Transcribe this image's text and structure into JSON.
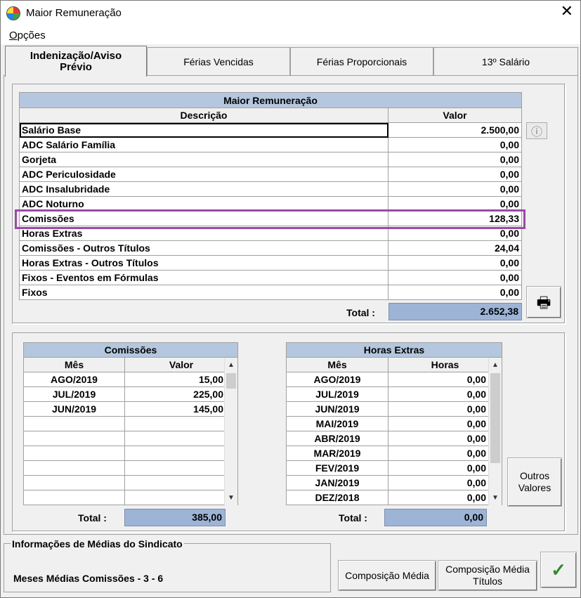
{
  "window": {
    "title": "Maior Remuneração",
    "close_glyph": "✕"
  },
  "menu": {
    "opcoes_first": "O",
    "opcoes_rest": "pções"
  },
  "tabs": [
    {
      "label": "Indenização/Aviso Prévio"
    },
    {
      "label": "Férias Vencidas"
    },
    {
      "label": "Férias Proporcionais"
    },
    {
      "label": "13º Salário"
    }
  ],
  "main_table": {
    "title": "Maior Remuneração",
    "col_desc": "Descrição",
    "col_valor": "Valor",
    "rows": [
      {
        "desc": "Salário Base",
        "valor": "2.500,00"
      },
      {
        "desc": "ADC Salário Família",
        "valor": "0,00"
      },
      {
        "desc": "Gorjeta",
        "valor": "0,00"
      },
      {
        "desc": "ADC Periculosidade",
        "valor": "0,00"
      },
      {
        "desc": "ADC Insalubridade",
        "valor": "0,00"
      },
      {
        "desc": "ADC Noturno",
        "valor": "0,00"
      },
      {
        "desc": "Comissões",
        "valor": "128,33"
      },
      {
        "desc": "Horas Extras",
        "valor": "0,00"
      },
      {
        "desc": "Comissões - Outros Títulos",
        "valor": "24,04"
      },
      {
        "desc": "Horas Extras - Outros Títulos",
        "valor": "0,00"
      },
      {
        "desc": "Fixos - Eventos em Fórmulas",
        "valor": "0,00"
      },
      {
        "desc": "Fixos",
        "valor": "0,00"
      }
    ],
    "total_label": "Total :",
    "total_value": "2.652,38"
  },
  "comissoes": {
    "title": "Comissões",
    "col_mes": "Mês",
    "col_valor": "Valor",
    "rows": [
      {
        "mes": "AGO/2019",
        "valor": "15,00"
      },
      {
        "mes": "JUL/2019",
        "valor": "225,00"
      },
      {
        "mes": "JUN/2019",
        "valor": "145,00"
      },
      {
        "mes": "",
        "valor": ""
      },
      {
        "mes": "",
        "valor": ""
      },
      {
        "mes": "",
        "valor": ""
      },
      {
        "mes": "",
        "valor": ""
      },
      {
        "mes": "",
        "valor": ""
      },
      {
        "mes": "",
        "valor": ""
      }
    ],
    "total_label": "Total :",
    "total_value": "385,00"
  },
  "horas_extras": {
    "title": "Horas Extras",
    "col_mes": "Mês",
    "col_horas": "Horas",
    "rows": [
      {
        "mes": "AGO/2019",
        "horas": "0,00"
      },
      {
        "mes": "JUL/2019",
        "horas": "0,00"
      },
      {
        "mes": "JUN/2019",
        "horas": "0,00"
      },
      {
        "mes": "MAI/2019",
        "horas": "0,00"
      },
      {
        "mes": "ABR/2019",
        "horas": "0,00"
      },
      {
        "mes": "MAR/2019",
        "horas": "0,00"
      },
      {
        "mes": "FEV/2019",
        "horas": "0,00"
      },
      {
        "mes": "JAN/2019",
        "horas": "0,00"
      },
      {
        "mes": "DEZ/2018",
        "horas": "0,00"
      }
    ],
    "total_label": "Total :",
    "total_value": "0,00"
  },
  "buttons": {
    "info_glyph": "ⓘ",
    "print_glyph": "🖶",
    "outros_valores": "Outros Valores",
    "composicao_media": "Composição Média",
    "composicao_media_titulos": "Composição Média Títulos",
    "ok_glyph": "✓"
  },
  "scroll": {
    "up": "▲",
    "down": "▼"
  },
  "sindicato": {
    "title": "Informações de Médias do Sindicato",
    "text": "Meses Médias Comissões - 3 - 6"
  },
  "colors": {
    "header_blue": "#b5c7de",
    "total_blue": "#9db4d6",
    "highlight": "#9b4aa6",
    "ok_green": "#2e8b2e"
  }
}
